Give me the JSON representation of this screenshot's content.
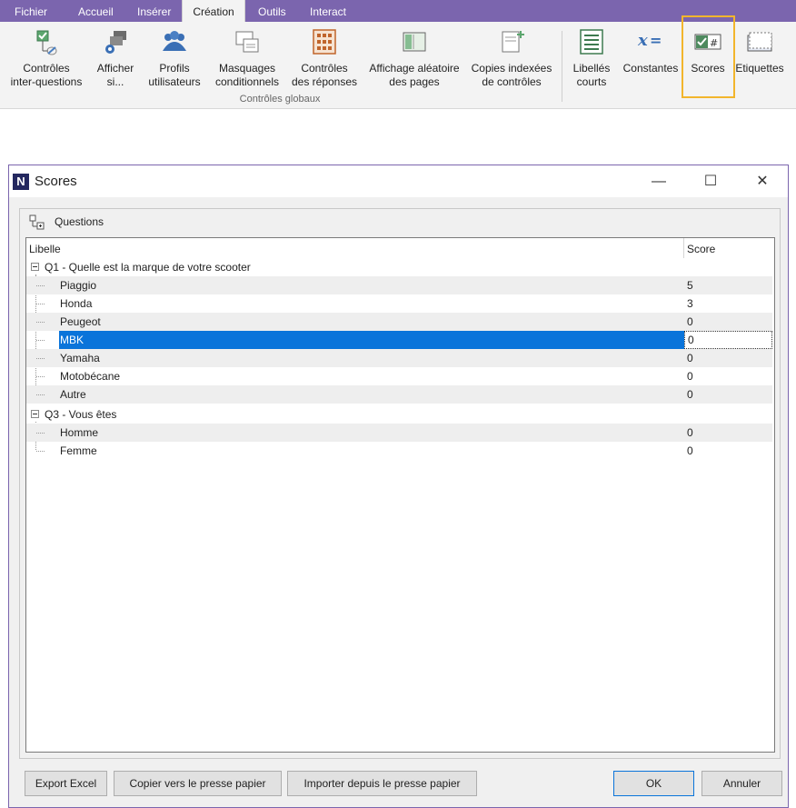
{
  "ribbon": {
    "tabs": [
      {
        "label": "Fichier"
      },
      {
        "label": "Accueil"
      },
      {
        "label": "Insérer"
      },
      {
        "label": "Création"
      },
      {
        "label": "Outils"
      },
      {
        "label": "Interact"
      }
    ],
    "active_tab": "Création",
    "buttons": [
      {
        "label": "Contrôles\ninter-questions",
        "icon": "inter-question-controls-icon"
      },
      {
        "label": "Afficher\nsi...",
        "icon": "display-if-icon"
      },
      {
        "label": "Profils\nutilisateurs",
        "icon": "user-profiles-icon"
      },
      {
        "label": "Masquages\nconditionnels",
        "icon": "conditional-masking-icon"
      },
      {
        "label": "Contrôles\ndes réponses",
        "icon": "answer-controls-icon"
      },
      {
        "label": "Affichage aléatoire\ndes pages",
        "icon": "random-pages-icon"
      },
      {
        "label": "Copies indexées\nde contrôles",
        "icon": "indexed-copies-icon"
      },
      {
        "label": "Libellés\ncourts",
        "icon": "short-labels-icon"
      },
      {
        "label": "Constantes",
        "icon": "constants-icon"
      },
      {
        "label": "Scores",
        "icon": "scores-icon"
      },
      {
        "label": "Etiquettes",
        "icon": "tags-icon"
      }
    ],
    "group_label": "Contrôles globaux",
    "accent_color": "#7b65ae",
    "highlight_color": "#f2b52c"
  },
  "dialog": {
    "title": "Scores",
    "app_icon_letter": "N",
    "window_buttons": {
      "minimize": "—",
      "maximize": "☐",
      "close": "✕"
    },
    "group_title": "Questions",
    "columns": {
      "label": "Libelle",
      "score": "Score"
    },
    "questions": [
      {
        "label": "Q1 - Quelle est la marque de votre scooter",
        "answers": [
          {
            "label": "Piaggio",
            "score": "5"
          },
          {
            "label": "Honda",
            "score": "3"
          },
          {
            "label": "Peugeot",
            "score": "0"
          },
          {
            "label": "MBK",
            "score": "0",
            "selected": true
          },
          {
            "label": "Yamaha",
            "score": "0"
          },
          {
            "label": "Motobécane",
            "score": "0"
          },
          {
            "label": "Autre",
            "score": "0"
          }
        ]
      },
      {
        "label": "Q3 - Vous êtes",
        "answers": [
          {
            "label": "Homme",
            "score": "0"
          },
          {
            "label": "Femme",
            "score": "0"
          }
        ]
      }
    ],
    "selection_color": "#0a74da",
    "buttons": {
      "export_excel": "Export Excel",
      "copy_clipboard": "Copier vers le presse papier",
      "import_clipboard": "Importer depuis le presse papier",
      "ok": "OK",
      "cancel": "Annuler"
    }
  }
}
